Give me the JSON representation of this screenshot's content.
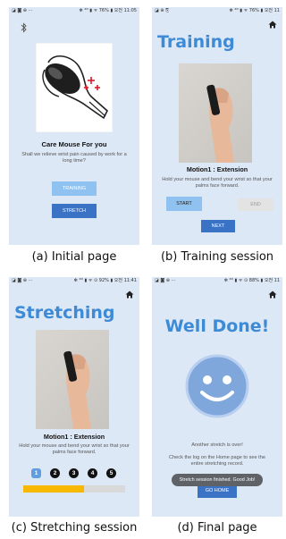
{
  "captions": {
    "a": "(a) Initial page",
    "b": "(b) Training session",
    "c": "(c) Stretching session",
    "d": "(d) Final page"
  },
  "status_bars": {
    "a": {
      "left": "◪ ◙ ⊕  ···",
      "right": "✻ ⁴ᴳ ▮ ᯤ 76% ▮ 오전 11:05"
    },
    "b": {
      "left": "◪ ⊕ ⎘",
      "right": "✻ ⁴ᴳ ▮ ᯤ 76% ▮ 오전 11"
    },
    "c": {
      "left": "◪ ◙ ⊕  ···",
      "right": "✻ ⁴ᴳ ▮ ᯤ ⊙ 92% ▮ 오전 11:41"
    },
    "d": {
      "left": "◪ ◙ ⊕  ···",
      "right": "✻ ⁴ᴳ ▮ ᯤ ⊙ 88% ▮ 오전 11"
    }
  },
  "initial": {
    "title": "Care Mouse For you",
    "subtitle": "Shall we relieve wrist pain caused by work for a long time?",
    "training_button": "TRAINING",
    "stretch_button": "STRETCH"
  },
  "training": {
    "title": "Training",
    "motion_title": "Motion1 : Extension",
    "instruction": "Hold your mouse and bend your wrist so that your palms face forward.",
    "start_button": "START",
    "end_button": "END",
    "next_button": "NEXT"
  },
  "stretching": {
    "title": "Stretching",
    "motion_title": "Motion1 : Extension",
    "instruction": "Hold your mouse and bend your wrist so that your palms face forward.",
    "steps": [
      "1",
      "2",
      "3",
      "4",
      "5"
    ],
    "current_step": 1,
    "progress": 0.6
  },
  "final": {
    "title": "Well Done!",
    "line1": "Another stretch is over!",
    "line2": "Check the log on the Home page to see the entire stretching record.",
    "toast": "Stretch session finished. Good Job!",
    "home_button": "GO HOME"
  },
  "colors": {
    "background": "#dde8f6",
    "accent": "#3d8bd6",
    "button_primary": "#3a72c6",
    "button_light": "#8fc2f0",
    "progress_fill": "#f9b800",
    "progress_track": "#d9d9d9",
    "toast_bg": "#5f6368"
  }
}
